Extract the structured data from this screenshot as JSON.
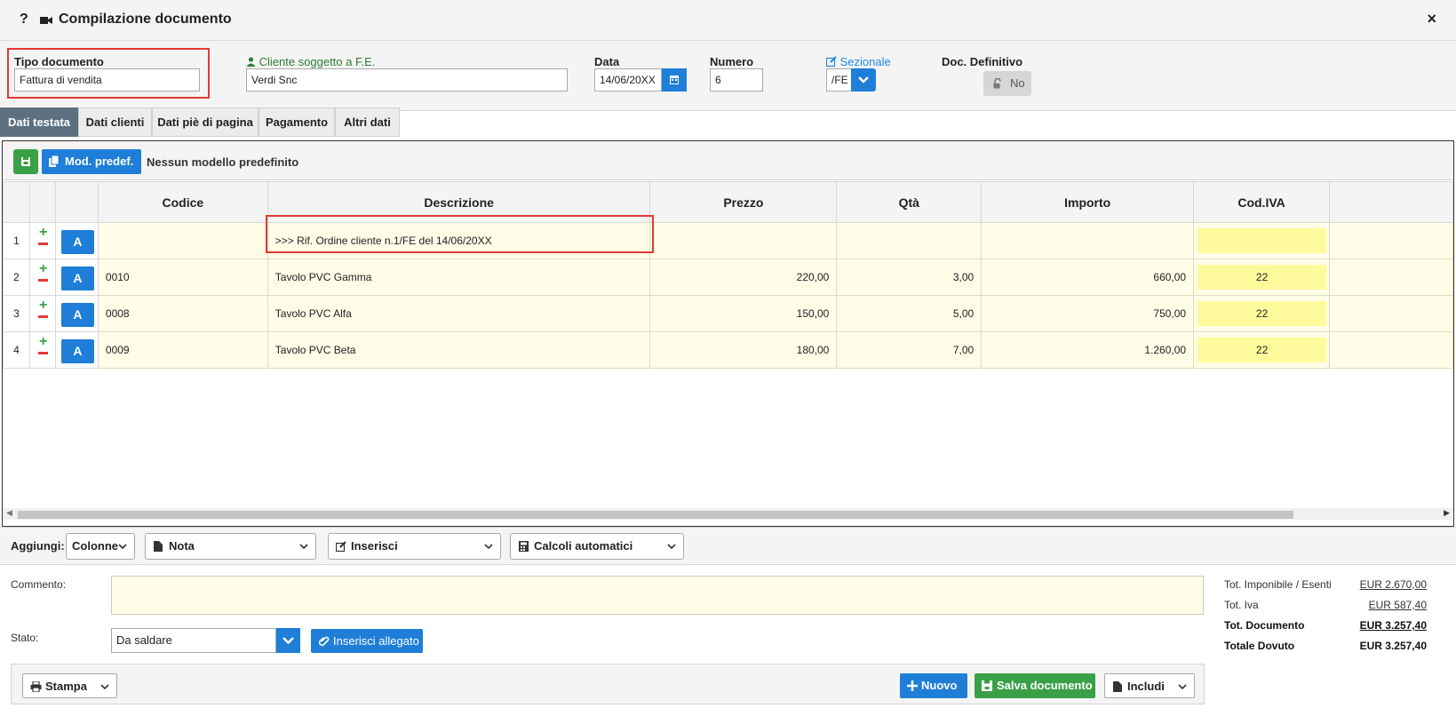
{
  "window": {
    "help": "?",
    "title": "Compilazione documento",
    "close": "×"
  },
  "header": {
    "tipo_label": "Tipo documento",
    "tipo_value": "Fattura di vendita",
    "cliente_label": "Cliente soggetto a F.E.",
    "cliente_value": "Verdi Snc",
    "data_label": "Data",
    "data_value": "14/06/20XX",
    "numero_label": "Numero",
    "numero_value": "6",
    "sezionale_label": "Sezionale",
    "sezionale_value": "/FE",
    "definitivo_label": "Doc. Definitivo",
    "definitivo_value": "No"
  },
  "tabs": [
    "Dati testata",
    "Dati clienti",
    "Dati piè di pagina",
    "Pagamento",
    "Altri dati"
  ],
  "toolbar": {
    "mod_label": "Mod. predef.",
    "no_model": "Nessun modello predefinito"
  },
  "grid": {
    "columns": [
      "Codice",
      "Descrizione",
      "Prezzo",
      "Qtà",
      "Importo",
      "Cod.IVA"
    ],
    "action_letter": "A",
    "rows": [
      {
        "n": "1",
        "codice": "",
        "descrizione": ">>> Rif. Ordine cliente n.1/FE del 14/06/20XX",
        "prezzo": "",
        "qta": "",
        "importo": "",
        "iva": ""
      },
      {
        "n": "2",
        "codice": "0010",
        "descrizione": "Tavolo PVC Gamma",
        "prezzo": "220,00",
        "qta": "3,00",
        "importo": "660,00",
        "iva": "22"
      },
      {
        "n": "3",
        "codice": "0008",
        "descrizione": "Tavolo PVC Alfa",
        "prezzo": "150,00",
        "qta": "5,00",
        "importo": "750,00",
        "iva": "22"
      },
      {
        "n": "4",
        "codice": "0009",
        "descrizione": "Tavolo PVC Beta",
        "prezzo": "180,00",
        "qta": "7,00",
        "importo": "1.260,00",
        "iva": "22"
      }
    ]
  },
  "addbar": {
    "label": "Aggiungi:",
    "colonne": "Colonne",
    "nota": "Nota",
    "inserisci": "Inserisci",
    "calcoli": "Calcoli automatici"
  },
  "footer": {
    "commento_label": "Commento:",
    "stato_label": "Stato:",
    "stato_value": "Da saldare",
    "allegato": "Inserisci allegato",
    "totals": [
      {
        "label": "Tot. Imponibile / Esenti",
        "value": "EUR 2.670,00"
      },
      {
        "label": "Tot. Iva",
        "value": "EUR 587,40"
      },
      {
        "label": "Tot. Documento",
        "value": "EUR 3.257,40"
      },
      {
        "label": "Totale Dovuto",
        "value": "EUR 3.257,40"
      }
    ],
    "stampa": "Stampa",
    "nuovo": "Nuovo",
    "salva": "Salva documento",
    "includi": "Includi"
  },
  "colors": {
    "accent": "#1e7ed8",
    "success": "#3aa047",
    "danger": "#e53935",
    "tab_active": "#5c7080",
    "row_bg": "#fefde8",
    "iva_bg": "#fffb9c"
  }
}
